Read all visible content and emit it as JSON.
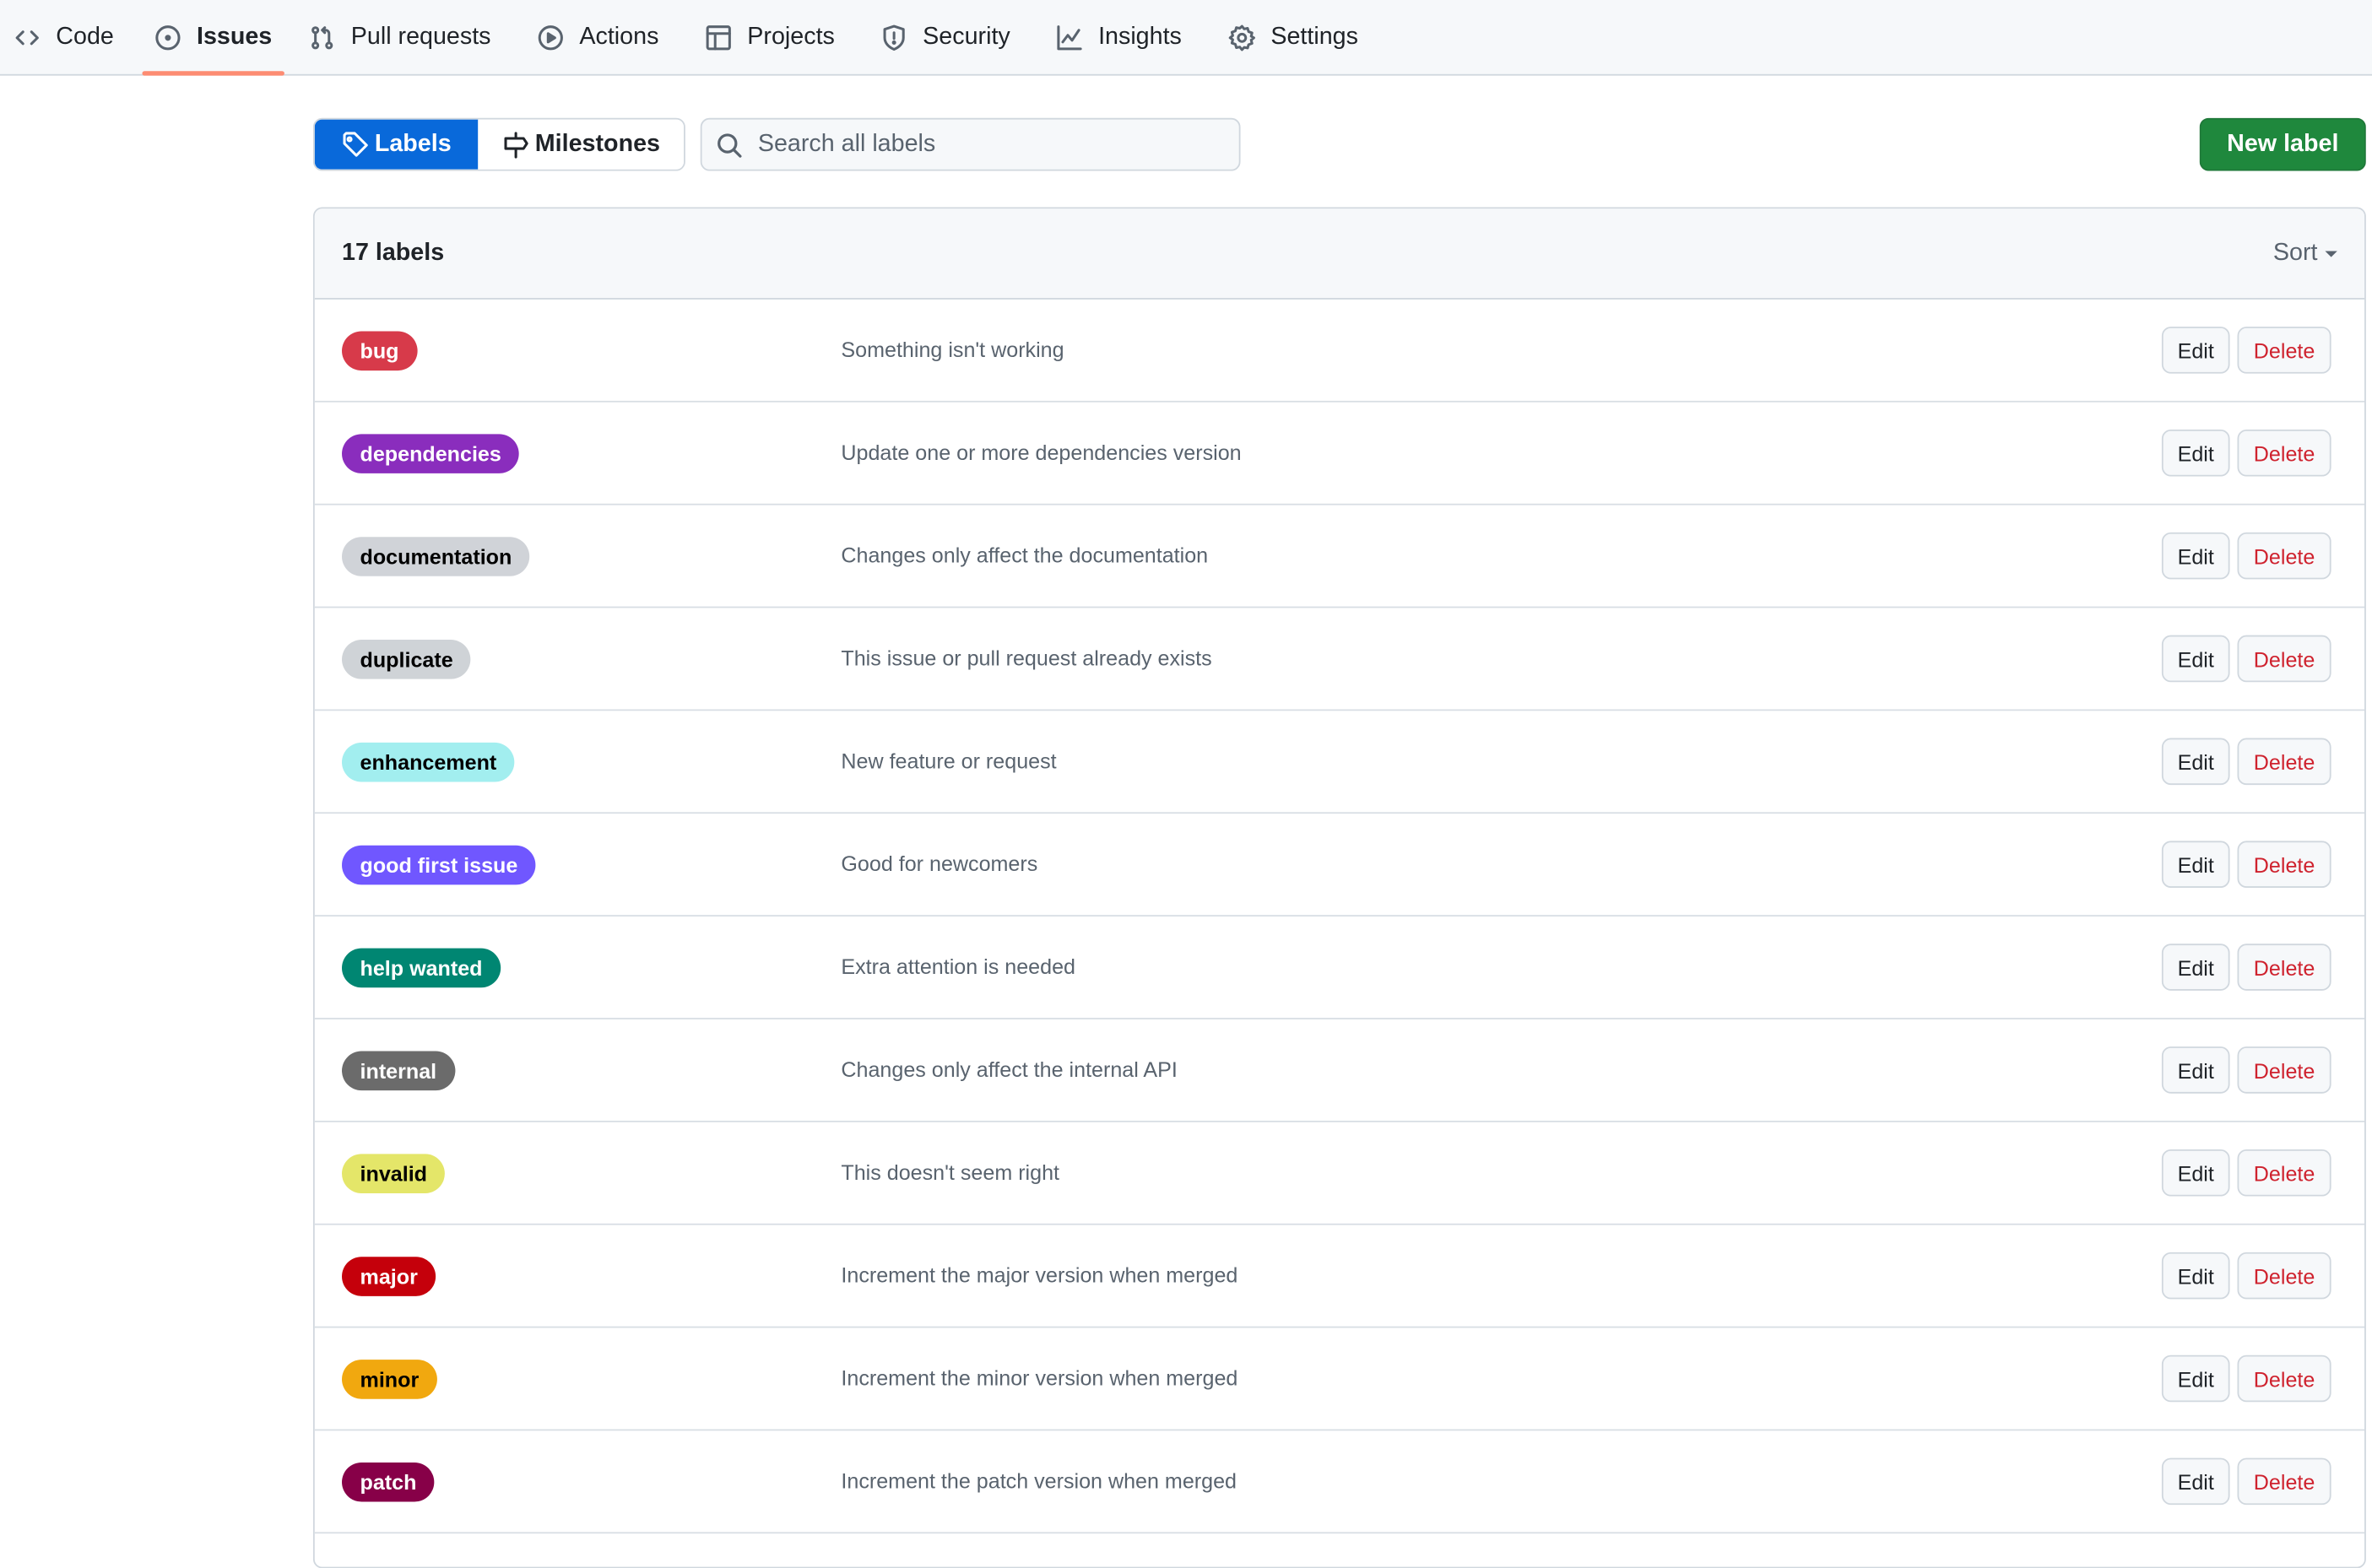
{
  "nav": {
    "tabs": [
      {
        "label": "Code",
        "icon": "code-icon",
        "active": false
      },
      {
        "label": "Issues",
        "icon": "issue-opened-icon",
        "active": true
      },
      {
        "label": "Pull requests",
        "icon": "git-pull-request-icon",
        "active": false
      },
      {
        "label": "Actions",
        "icon": "play-icon",
        "active": false
      },
      {
        "label": "Projects",
        "icon": "table-icon",
        "active": false
      },
      {
        "label": "Security",
        "icon": "shield-icon",
        "active": false
      },
      {
        "label": "Insights",
        "icon": "graph-icon",
        "active": false
      },
      {
        "label": "Settings",
        "icon": "gear-icon",
        "active": false
      }
    ],
    "active_underline_color": "#fd8c73"
  },
  "toolbar": {
    "labels_tab": "Labels",
    "milestones_tab": "Milestones",
    "search_placeholder": "Search all labels",
    "search_value": "",
    "new_label_button": "New label"
  },
  "list": {
    "count_text": "17 labels",
    "sort_label": "Sort",
    "edit_label": "Edit",
    "delete_label": "Delete",
    "labels": [
      {
        "name": "bug",
        "description": "Something isn't working",
        "color": "#d73a4a",
        "text_color": "#ffffff"
      },
      {
        "name": "dependencies",
        "description": "Update one or more dependencies version",
        "color": "#8a2dbd",
        "text_color": "#ffffff"
      },
      {
        "name": "documentation",
        "description": "Changes only affect the documentation",
        "color": "#d0d3d8",
        "text_color": "#000000"
      },
      {
        "name": "duplicate",
        "description": "This issue or pull request already exists",
        "color": "#cfd3d7",
        "text_color": "#000000"
      },
      {
        "name": "enhancement",
        "description": "New feature or request",
        "color": "#a2eeef",
        "text_color": "#000000"
      },
      {
        "name": "good first issue",
        "description": "Good for newcomers",
        "color": "#7057ff",
        "text_color": "#ffffff"
      },
      {
        "name": "help wanted",
        "description": "Extra attention is needed",
        "color": "#008672",
        "text_color": "#ffffff"
      },
      {
        "name": "internal",
        "description": "Changes only affect the internal API",
        "color": "#6b6b6b",
        "text_color": "#ffffff"
      },
      {
        "name": "invalid",
        "description": "This doesn't seem right",
        "color": "#e4e669",
        "text_color": "#000000"
      },
      {
        "name": "major",
        "description": "Increment the major version when merged",
        "color": "#c5000b",
        "text_color": "#ffffff"
      },
      {
        "name": "minor",
        "description": "Increment the minor version when merged",
        "color": "#f1a80f",
        "text_color": "#000000"
      },
      {
        "name": "patch",
        "description": "Increment the patch version when merged",
        "color": "#870048",
        "text_color": "#ffffff"
      }
    ]
  }
}
